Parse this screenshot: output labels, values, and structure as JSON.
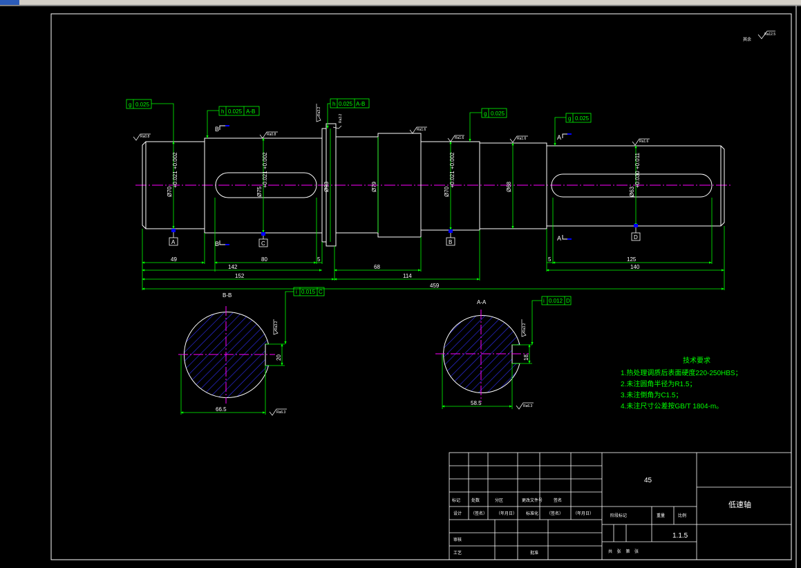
{
  "colors": {
    "background": "#000000",
    "outline": "#ffffff",
    "dimension": "#00ff00",
    "centerline": "#ff00ff",
    "hatch": "#3030ff",
    "datum_marker": "#0000ff"
  },
  "roughness": {
    "general": "Ra12.5",
    "left_end": "Ra0.8",
    "key_left": "Ra0.8",
    "flange": "Ra1.6",
    "mid": "Ra1.6",
    "right_step": "Ra1.6",
    "right_end": "Ra1.6",
    "section_bb": "Ra3.2",
    "section_bb_bottom": "Ra6.3",
    "section_aa": "Ra3.2",
    "section_aa_bottom": "Ra6.3",
    "flange_face": "Ra3.2",
    "general_prefix": "其余"
  },
  "tolerance_frames": [
    {
      "symbol": "g",
      "value": "0.025",
      "datum": ""
    },
    {
      "symbol": "h",
      "value": "0.025",
      "datum": "A-B"
    },
    {
      "symbol": "h",
      "value": "0.025",
      "datum": "A-B"
    },
    {
      "symbol": "g",
      "value": "0.025",
      "datum": ""
    },
    {
      "symbol": "g",
      "value": "0.025",
      "datum": ""
    },
    {
      "symbol": "i",
      "value": "0.015",
      "datum": "C"
    },
    {
      "symbol": "i",
      "value": "0.012",
      "datum": "D"
    }
  ],
  "datums": [
    "A",
    "C",
    "B",
    "D"
  ],
  "section_marks": [
    "B",
    "B",
    "A",
    "A"
  ],
  "diameters": [
    "Ø70",
    "Ø75",
    "Ø93",
    "Ø79",
    "Ø70",
    "Ø68",
    "Ø63"
  ],
  "diameter_tolerances": [
    "+0.021 +0.002",
    "+0.021 +0.002",
    "+0.021 +0.002",
    "+0.030 +0.011"
  ],
  "dimensions": {
    "d49": "49",
    "d142": "142",
    "d80": "80",
    "d5a": "5",
    "d68": "68",
    "d5b": "5",
    "d125": "125",
    "d152": "152",
    "d114": "114",
    "d140": "140",
    "d459": "459"
  },
  "sections": {
    "bb_title": "B-B",
    "aa_title": "A-A",
    "bb_width": "66.5",
    "bb_key": "20",
    "aa_width": "58.5",
    "aa_key": "18"
  },
  "tech_notes": {
    "title": "技术要求",
    "lines": [
      "1.热处理调质后表面硬度220-250HBS；",
      "2.未注圆角半径为R1.5；",
      "3.未注倒角为C1.5；",
      "4.未注尺寸公差按GB/T 1804-m。"
    ]
  },
  "title_block": {
    "material": "45",
    "part_name": "低速轴",
    "drawing_no": "1.1.5",
    "row_labels": [
      "标记",
      "处数",
      "分区",
      "更改文件号",
      "签名"
    ],
    "design": "设计",
    "sign_name": "（签名）",
    "date": "（年月日）",
    "standardization": "标准化",
    "stage_mark": "阶段标记",
    "weight": "重量",
    "scale": "比例",
    "review": "审核",
    "process": "工艺",
    "approve": "批准",
    "sheets": "共    张    第    张"
  }
}
